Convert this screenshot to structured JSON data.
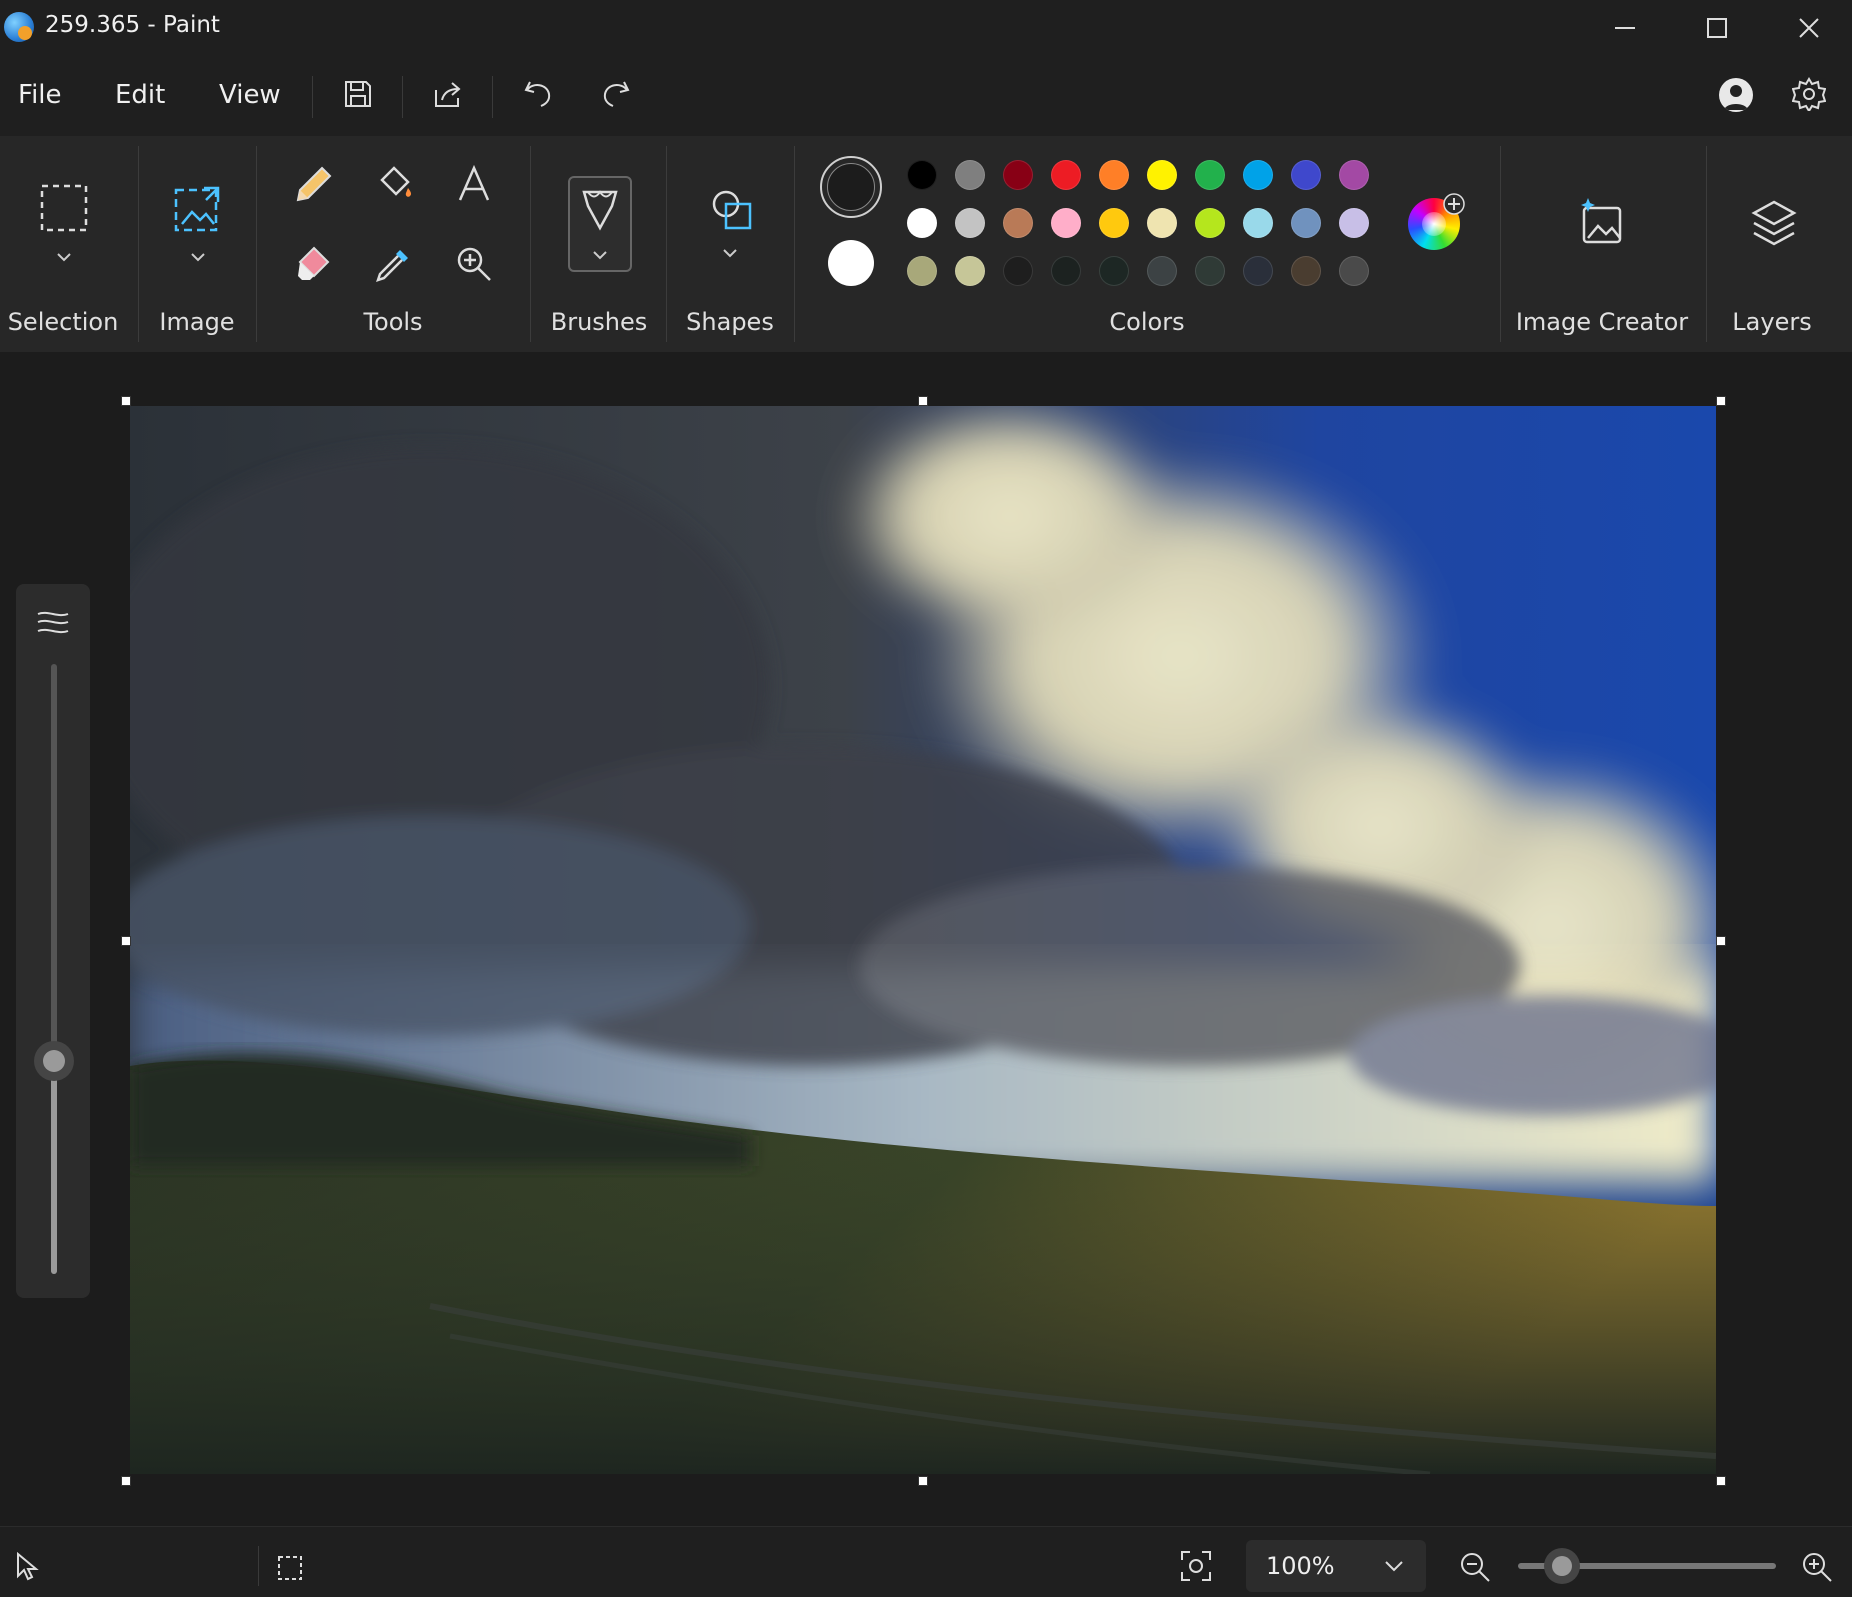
{
  "window": {
    "title": "259.365 - Paint"
  },
  "menu": {
    "file": "File",
    "edit": "Edit",
    "view": "View"
  },
  "ribbon": {
    "groups": {
      "selection": "Selection",
      "image": "Image",
      "tools": "Tools",
      "brushes": "Brushes",
      "shapes": "Shapes",
      "colors": "Colors",
      "image_creator": "Image Creator",
      "layers": "Layers"
    },
    "colors": {
      "primary": "#1c1c1c",
      "secondary": "#ffffff",
      "palette_row1": [
        "#000000",
        "#7f7f7f",
        "#880015",
        "#ed1c24",
        "#ff7f27",
        "#fff200",
        "#22b14c",
        "#00a2e8",
        "#3f48cc",
        "#a349a4"
      ],
      "palette_row2": [
        "#ffffff",
        "#c3c3c3",
        "#b97a57",
        "#ffaec9",
        "#ffc90e",
        "#efe4b0",
        "#b5e61d",
        "#99d9ea",
        "#7092be",
        "#c8bfe7"
      ],
      "palette_row3": [
        "#a8a87a",
        "#c6c698",
        "#1e1e1e",
        "#1c2220",
        "#1d2724",
        "#3c4244",
        "#2f3a36",
        "#2a2f3a",
        "#4a3d30",
        "#4a4a4a"
      ]
    }
  },
  "status": {
    "zoom": "100%",
    "zoom_level": 0.17
  },
  "side_slider": {
    "level": 0.35
  }
}
